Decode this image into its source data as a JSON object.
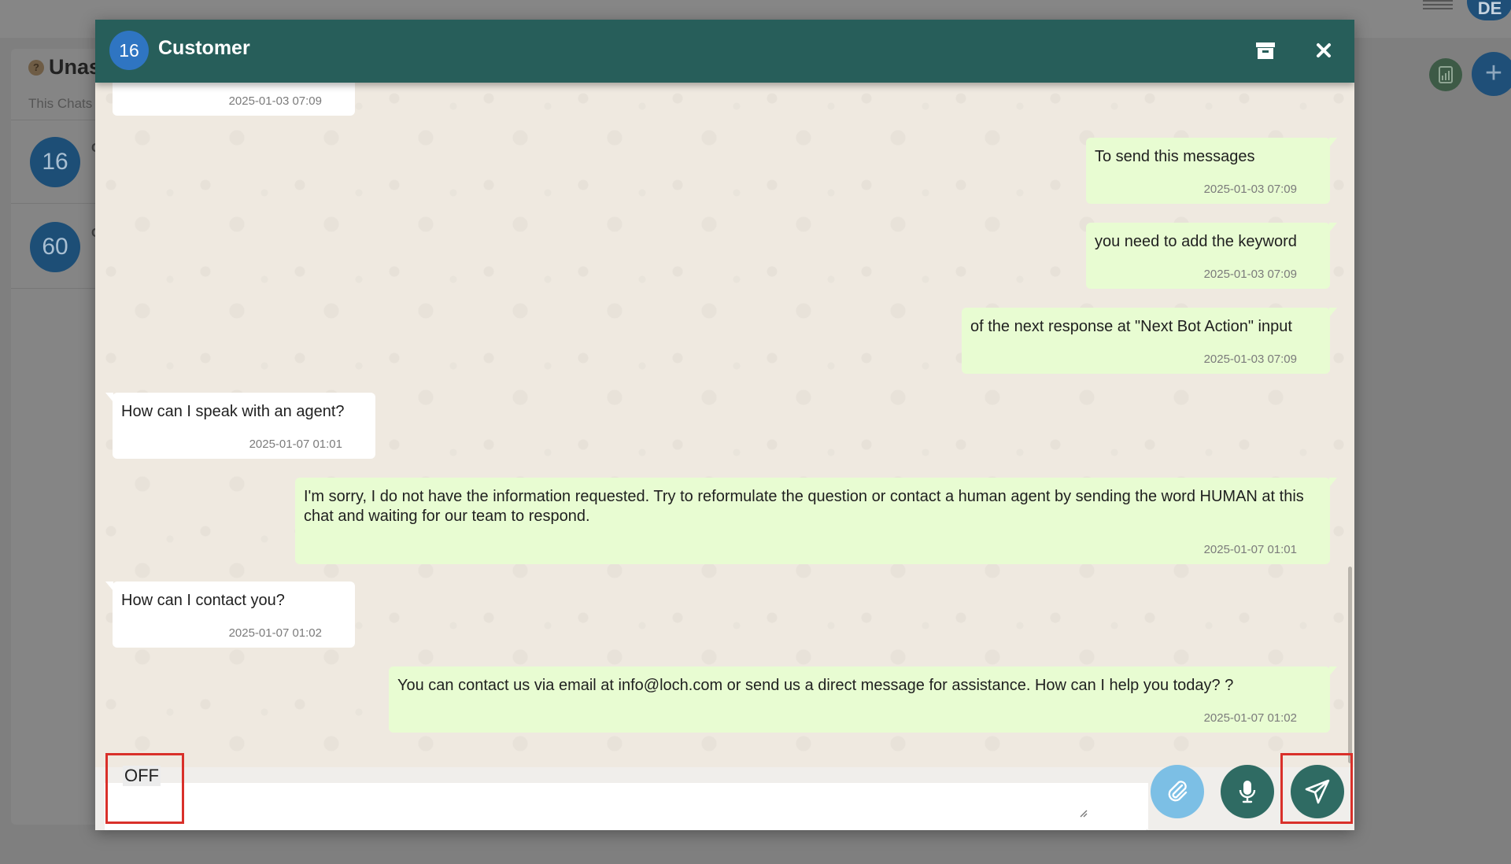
{
  "background": {
    "panel_title": "Unas",
    "panel_subtitle": "This Chats",
    "user_avatar_initials": "DE",
    "chats": [
      {
        "avatar": "16",
        "initial": "C"
      },
      {
        "avatar": "60",
        "initial": "C"
      }
    ],
    "icons": {
      "help": "question-icon",
      "report": "report-icon",
      "add": "plus-icon",
      "menu": "hamburger-icon"
    }
  },
  "modal": {
    "avatar_number": "16",
    "title": "Customer",
    "archive_icon": "archive-icon",
    "close_label": "✕"
  },
  "messages": [
    {
      "direction": "in",
      "text": "",
      "time": "2025-01-03 07:09"
    },
    {
      "direction": "out",
      "text": "To send this messages",
      "time": "2025-01-03 07:09"
    },
    {
      "direction": "out",
      "text": "you need to add the keyword",
      "time": "2025-01-03 07:09"
    },
    {
      "direction": "out",
      "text": "of the next response at \"Next Bot Action\" input",
      "time": "2025-01-03 07:09"
    },
    {
      "direction": "in",
      "text": "How can I speak with an agent?",
      "time": "2025-01-07 01:01"
    },
    {
      "direction": "out",
      "text": "I'm sorry, I do not have the information requested. Try to reformulate the question or contact a human agent by sending the word HUMAN at this chat and waiting for our team to respond.",
      "time": "2025-01-07 01:01"
    },
    {
      "direction": "in",
      "text": "How can I contact you?",
      "time": "2025-01-07 01:02"
    },
    {
      "direction": "out",
      "text": "You can contact us via email at info@loch.com or send us a direct message for assistance. How can I help you today? ?",
      "time": "2025-01-07 01:02"
    }
  ],
  "composer": {
    "input_value": "OFF",
    "icons": {
      "attach": "paperclip-icon",
      "mic": "microphone-icon",
      "send": "send-icon"
    }
  },
  "colors": {
    "header": "#275e5a",
    "outgoing_bubble": "#e8fcd2",
    "incoming_bubble": "#ffffff",
    "chat_background": "#efe9e0",
    "attach_button": "#7cbfe5",
    "action_button": "#2f6b63",
    "highlight": "#d9302a"
  }
}
